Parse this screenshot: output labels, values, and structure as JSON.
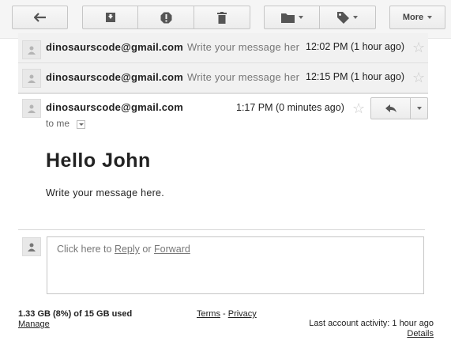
{
  "toolbar": {
    "more_label": "More",
    "buttons": [
      "back-arrow-icon",
      "archive-icon",
      "report-spam-icon",
      "delete-icon",
      "folder-icon",
      "label-icon"
    ]
  },
  "thread": [
    {
      "sender": "dinosaurscode@gmail.com",
      "snippet": "Write your message here.",
      "time": "12:02 PM (1 hour ago)"
    },
    {
      "sender": "dinosaurscode@gmail.com",
      "snippet": "Write your message here.",
      "time": "12:15 PM (1 hour ago)"
    }
  ],
  "open_message": {
    "sender": "dinosaurscode@gmail.com",
    "time": "1:17 PM (0 minutes ago)",
    "to": "to me",
    "heading": "Hello John",
    "body": "Write your message here."
  },
  "reply_box": {
    "prefix": "Click here to ",
    "reply": "Reply",
    "or": " or ",
    "forward": "Forward"
  },
  "footer": {
    "storage": "1.33 GB (8%) of 15 GB used",
    "manage": "Manage",
    "terms": "Terms",
    "sep": " - ",
    "privacy": "Privacy",
    "activity": "Last account activity: 1 hour ago",
    "details": "Details"
  }
}
